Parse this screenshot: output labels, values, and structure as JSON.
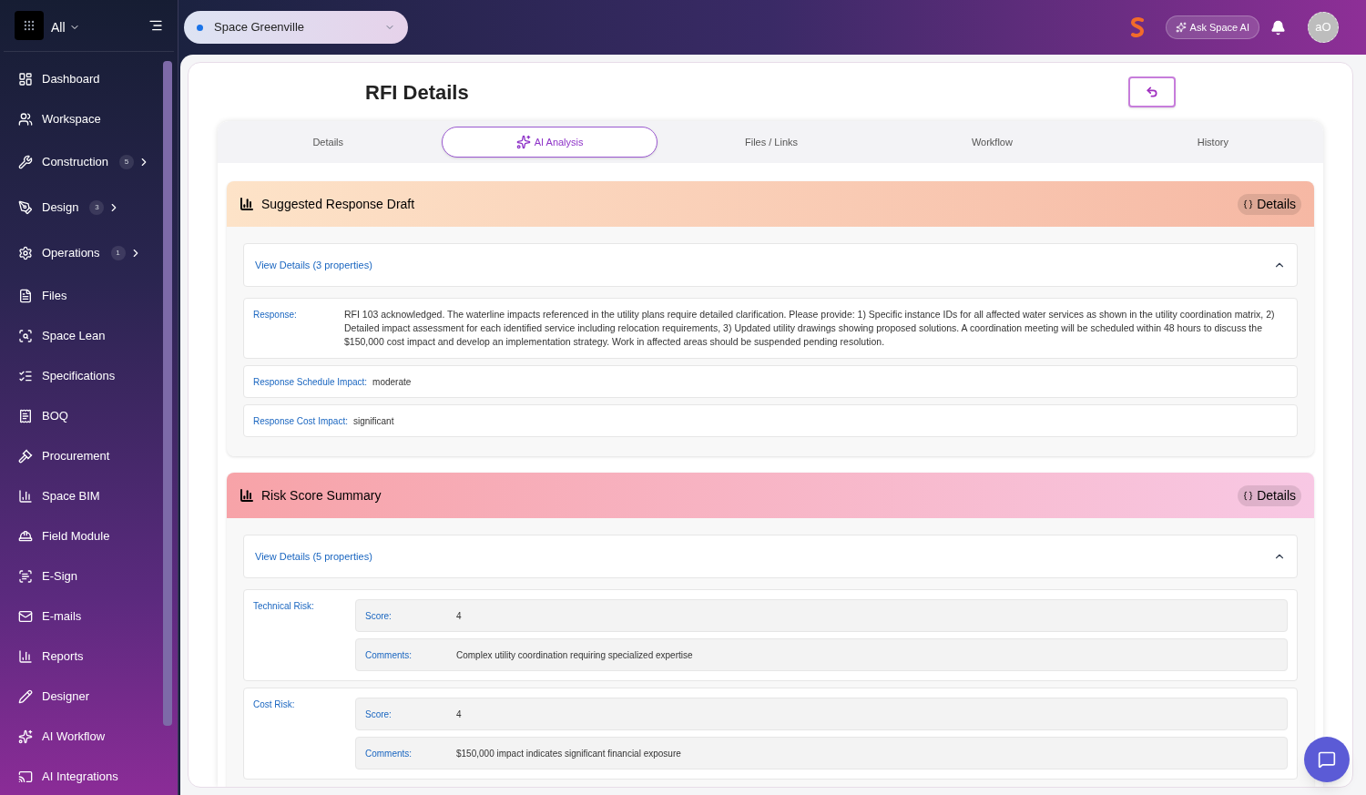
{
  "sidebar": {
    "workspace_switch": "All",
    "items": [
      {
        "label": "Dashboard"
      },
      {
        "label": "Workspace"
      },
      {
        "label": "Construction",
        "count": "5"
      },
      {
        "label": "Design",
        "count": "3"
      },
      {
        "label": "Operations",
        "count": "1"
      },
      {
        "label": "Files"
      },
      {
        "label": "Space Lean"
      },
      {
        "label": "Specifications"
      },
      {
        "label": "BOQ"
      },
      {
        "label": "Procurement"
      },
      {
        "label": "Space BIM"
      },
      {
        "label": "Field Module"
      },
      {
        "label": "E-Sign"
      },
      {
        "label": "E-mails"
      },
      {
        "label": "Reports"
      },
      {
        "label": "Designer"
      },
      {
        "label": "AI Workflow"
      },
      {
        "label": "AI Integrations"
      }
    ]
  },
  "topbar": {
    "project": "Space Greenville",
    "ask_ai": "Ask Space AI",
    "avatar": "aO"
  },
  "page": {
    "title": "RFI Details",
    "tabs": [
      {
        "label": "Details",
        "selected": false
      },
      {
        "label": "AI Analysis",
        "selected": true
      },
      {
        "label": "Files / Links",
        "selected": false
      },
      {
        "label": "Workflow",
        "selected": false
      },
      {
        "label": "History",
        "selected": false
      }
    ],
    "sections": [
      {
        "title": "Suggested Response Draft",
        "details_button": "Details",
        "view_details": "View Details (3 properties)",
        "expanded": true,
        "rows": [
          {
            "kind": "text",
            "label": "Response:",
            "value": "RFI 103 acknowledged. The waterline impacts referenced in the utility plans require detailed clarification. Please provide: 1) Specific instance IDs for all affected water services as shown in the utility coordination matrix, 2) Detailed impact assessment for each identified service including relocation requirements, 3) Updated utility drawings showing proposed solutions. A coordination meeting will be scheduled within 48 hours to discuss the $150,000 cost impact and develop an implementation strategy. Work in affected areas should be suspended pending resolution."
          },
          {
            "kind": "inline",
            "label": "Response Schedule Impact:",
            "value": "moderate"
          },
          {
            "kind": "inline",
            "label": "Response Cost Impact:",
            "value": "significant"
          }
        ]
      },
      {
        "title": "Risk Score Summary",
        "details_button": "Details",
        "view_details": "View Details (5 properties)",
        "expanded": true,
        "rows": [
          {
            "kind": "group",
            "label": "Technical Risk:",
            "fields": [
              {
                "label": "Score:",
                "value": "4"
              },
              {
                "label": "Comments:",
                "value": "Complex utility coordination requiring specialized expertise"
              }
            ]
          },
          {
            "kind": "group",
            "label": "Cost Risk:",
            "fields": [
              {
                "label": "Score:",
                "value": "4"
              },
              {
                "label": "Comments:",
                "value": "$150,000 impact indicates significant financial exposure"
              }
            ]
          }
        ]
      }
    ]
  }
}
